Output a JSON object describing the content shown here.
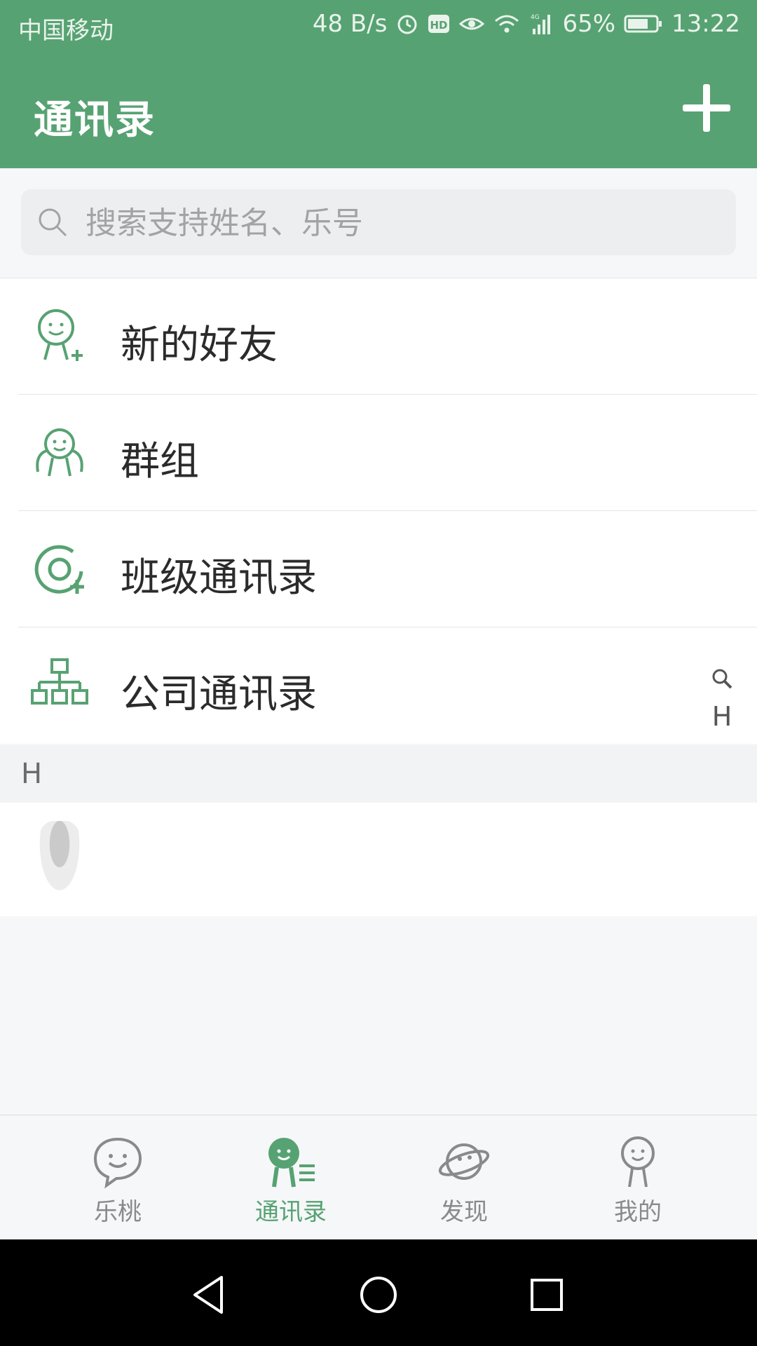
{
  "status_bar": {
    "carrier": "中国移动",
    "net_speed": "48 B/s",
    "battery": "65%",
    "time": "13:22",
    "icons": [
      "alarm-icon",
      "hd-icon",
      "eye-icon",
      "wifi-icon",
      "signal-4g-icon",
      "battery-icon"
    ]
  },
  "header": {
    "title": "通讯录",
    "add_icon": "plus-icon"
  },
  "search": {
    "placeholder": "搜索支持姓名、乐号",
    "value": ""
  },
  "menu": {
    "items": [
      {
        "label": "新的好友",
        "icon": "new-friend-icon"
      },
      {
        "label": "群组",
        "icon": "group-icon"
      },
      {
        "label": "班级通讯录",
        "icon": "class-contacts-icon"
      },
      {
        "label": "公司通讯录",
        "icon": "company-contacts-icon"
      }
    ]
  },
  "index_bar": {
    "search_icon": "search-icon",
    "letters": [
      "H"
    ]
  },
  "contacts": {
    "section_letter": "H",
    "rows": [
      {
        "avatar": "avatar"
      }
    ]
  },
  "tab_bar": {
    "tabs": [
      {
        "label": "乐桃",
        "icon": "chat-face-icon",
        "active": false
      },
      {
        "label": "通讯录",
        "icon": "contacts-icon",
        "active": true
      },
      {
        "label": "发现",
        "icon": "planet-icon",
        "active": false
      },
      {
        "label": "我的",
        "icon": "profile-icon",
        "active": false
      }
    ]
  },
  "colors": {
    "brand": "#57a272",
    "text": "#2b2b2b",
    "muted": "#8a8a8a",
    "background": "#f6f7f9"
  },
  "nav_bar": {
    "icons": [
      "back-icon",
      "home-icon",
      "recents-icon"
    ]
  }
}
